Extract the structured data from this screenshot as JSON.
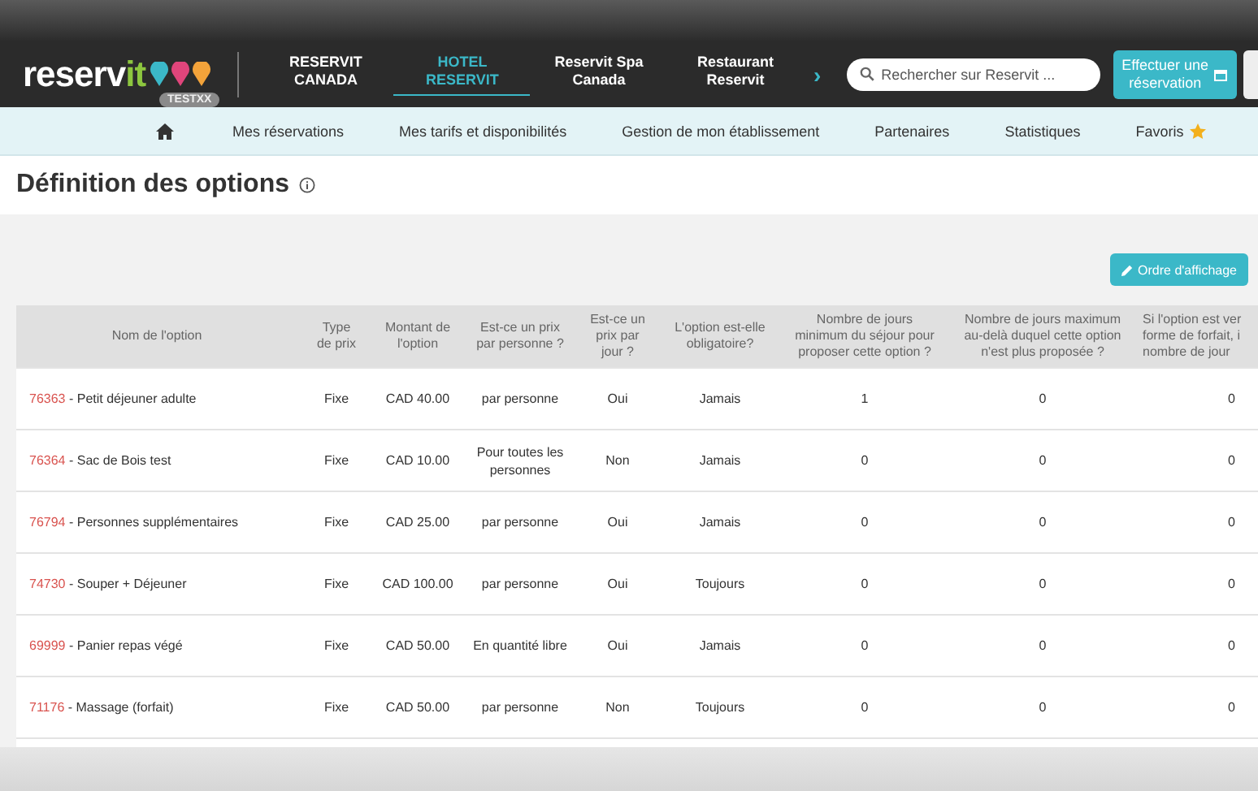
{
  "header": {
    "logo": {
      "text": "reserv",
      "accent": "it"
    },
    "badge": "TESTXX",
    "nav": [
      {
        "label": "RESERVIT\nCANADA",
        "selected": false
      },
      {
        "label": "HOTEL\nRESERVIT",
        "selected": true
      },
      {
        "label": "Reservit Spa\nCanada",
        "selected": false
      },
      {
        "label": "Restaurant\nReservit",
        "selected": false
      }
    ],
    "more": "›",
    "search": {
      "placeholder": "Rechercher sur Reservit ..."
    },
    "book_button": "Effectuer une\nréservation"
  },
  "subnav": [
    "Mes réservations",
    "Mes tarifs et disponibilités",
    "Gestion de mon établissement",
    "Partenaires",
    "Statistiques",
    "Favoris"
  ],
  "page_title": "Définition des options",
  "toolbar": {
    "order_button": "Ordre d'affichage"
  },
  "table": {
    "columns": [
      "Nom de l'option",
      "Type\nde prix",
      "Montant de\nl'option",
      "Est-ce un prix\npar personne ?",
      "Est-ce un\nprix par\njour ?",
      "L'option est-elle\nobligatoire?",
      "Nombre de jours\nminimum du séjour pour\nproposer cette option ?",
      "Nombre de jours maximum\nau-delà duquel cette option\nn'est plus proposée ?",
      "Si l'option est ver\nforme de forfait, i\nnombre de jour"
    ],
    "rows": [
      {
        "cells": [
          {
            "id": "76363",
            "name": " - Petit déjeuner adulte"
          },
          "Fixe",
          "CAD 40.00",
          "par personne",
          "Oui",
          "Jamais",
          "1",
          "0",
          "0"
        ]
      },
      {
        "cells": [
          {
            "id": "76364",
            "name": " - Sac de Bois test"
          },
          "Fixe",
          "CAD 10.00",
          "Pour toutes les personnes",
          "Non",
          "Jamais",
          "0",
          "0",
          "0"
        ]
      },
      {
        "cells": [
          {
            "id": "76794",
            "name": " - Personnes supplémentaires"
          },
          "Fixe",
          "CAD 25.00",
          "par personne",
          "Oui",
          "Jamais",
          "0",
          "0",
          "0"
        ]
      },
      {
        "cells": [
          {
            "id": "74730",
            "name": " - Souper + Déjeuner"
          },
          "Fixe",
          "CAD 100.00",
          "par personne",
          "Oui",
          "Toujours",
          "0",
          "0",
          "0"
        ]
      },
      {
        "cells": [
          {
            "id": "69999",
            "name": " - Panier repas végé"
          },
          "Fixe",
          "CAD 50.00",
          "En quantité libre",
          "Oui",
          "Jamais",
          "0",
          "0",
          "0"
        ]
      },
      {
        "cells": [
          {
            "id": "71176",
            "name": " - Massage (forfait)"
          },
          "Fixe",
          "CAD 50.00",
          "par personne",
          "Non",
          "Toujours",
          "0",
          "0",
          "0"
        ]
      }
    ]
  }
}
